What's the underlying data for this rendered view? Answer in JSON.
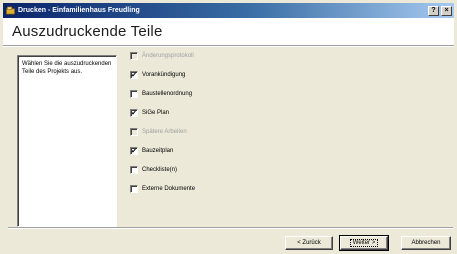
{
  "window": {
    "title": "Drucken - Einfamilienhaus Freudling",
    "help_label": "?",
    "close_label": "×"
  },
  "header": {
    "heading": "Auszudruckende Teile"
  },
  "description": "Wählen Sie die auszudruckenden Teile des Projekts aus.",
  "checkboxes": [
    {
      "label": "Änderungsprotokoll",
      "checked": false,
      "enabled": false
    },
    {
      "label": "Vorankündigung",
      "checked": true,
      "enabled": true
    },
    {
      "label": "Baustellenordnung",
      "checked": false,
      "enabled": true
    },
    {
      "label": "SiGe Plan",
      "checked": true,
      "enabled": true
    },
    {
      "label": "Spätere Arbeiten",
      "checked": false,
      "enabled": false
    },
    {
      "label": "Bauzeitplan",
      "checked": true,
      "enabled": true
    },
    {
      "label": "Checkliste(n)",
      "checked": false,
      "enabled": true
    },
    {
      "label": "Externe Dokumente",
      "checked": false,
      "enabled": true
    }
  ],
  "buttons": {
    "back": "< Zurück",
    "next": "Weiter >",
    "cancel": "Abbrechen"
  },
  "icons": {
    "app": "printer-folder-icon",
    "check": "check-mark-icon"
  }
}
